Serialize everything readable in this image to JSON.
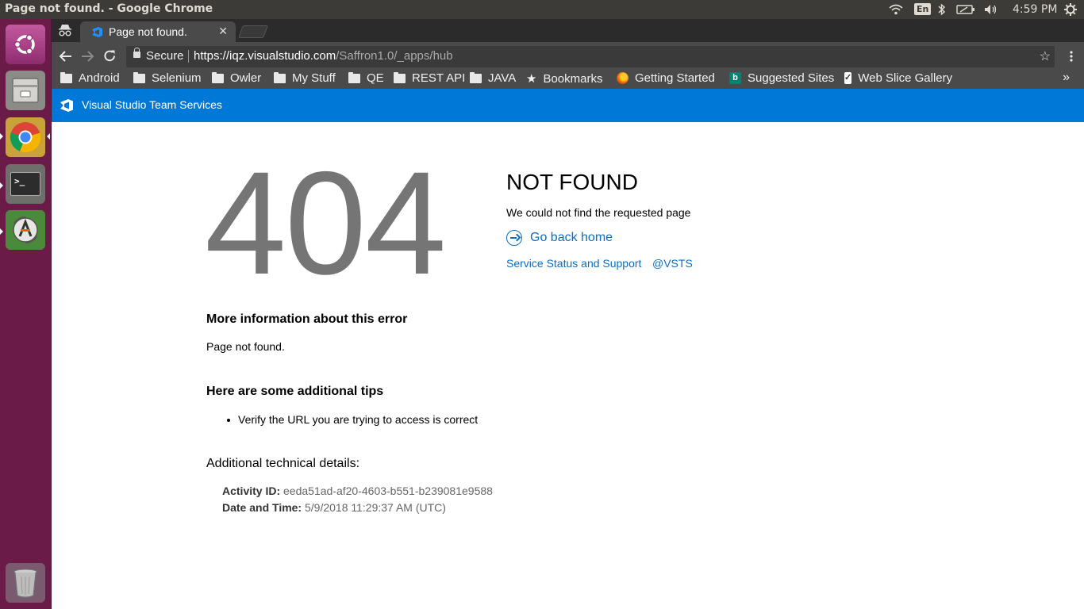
{
  "os_panel": {
    "window_title": "Page not found. - Google Chrome",
    "lang": "En",
    "time": "4:59 PM"
  },
  "launcher": {
    "items": [
      "ubuntu-dash-icon",
      "files-icon",
      "chrome-icon",
      "terminal-icon",
      "software-updater-icon",
      "trash-icon"
    ]
  },
  "browser": {
    "tab": {
      "title": "Page not found."
    },
    "omnibox": {
      "secure_label": "Secure",
      "url_host": "https://iqz.visualstudio.com",
      "url_path": "/Saffron1.0/_apps/hub"
    },
    "bookmarks": [
      {
        "label": "Android",
        "icon": "folder-icon"
      },
      {
        "label": "Selenium",
        "icon": "folder-icon"
      },
      {
        "label": "Owler",
        "icon": "folder-icon"
      },
      {
        "label": "My Stuff",
        "icon": "folder-icon"
      },
      {
        "label": "QE",
        "icon": "folder-icon"
      },
      {
        "label": "REST API",
        "icon": "folder-icon"
      },
      {
        "label": "JAVA",
        "icon": "folder-icon"
      },
      {
        "label": "Bookmarks",
        "icon": "star-icon"
      },
      {
        "label": "Getting Started",
        "icon": "firefox-icon"
      },
      {
        "label": "Suggested Sites",
        "icon": "bing-icon"
      },
      {
        "label": "Web Slice Gallery",
        "icon": "web-slice-icon"
      }
    ],
    "overflow": "»"
  },
  "vsts": {
    "header_title": "Visual Studio Team Services",
    "accent": "#0078d7"
  },
  "page": {
    "code": "404",
    "title": "NOT FOUND",
    "subtitle": "We could not find the requested page",
    "go_home": "Go back home",
    "status_link": "Service Status and Support",
    "vsts_link": "@VSTS",
    "more_info_heading": "More information about this error",
    "more_info_text": "Page not found.",
    "tips_heading": "Here are some additional tips",
    "tips": [
      "Verify the URL you are trying to access is correct"
    ],
    "tech_heading": "Additional technical details:",
    "activity_label": "Activity ID:",
    "activity_id": "eeda51ad-af20-4603-b551-b239081e9588",
    "datetime_label": "Date and Time:",
    "datetime": "5/9/2018 11:29:37 AM (UTC)",
    "link_color": "#0a6fc2"
  }
}
